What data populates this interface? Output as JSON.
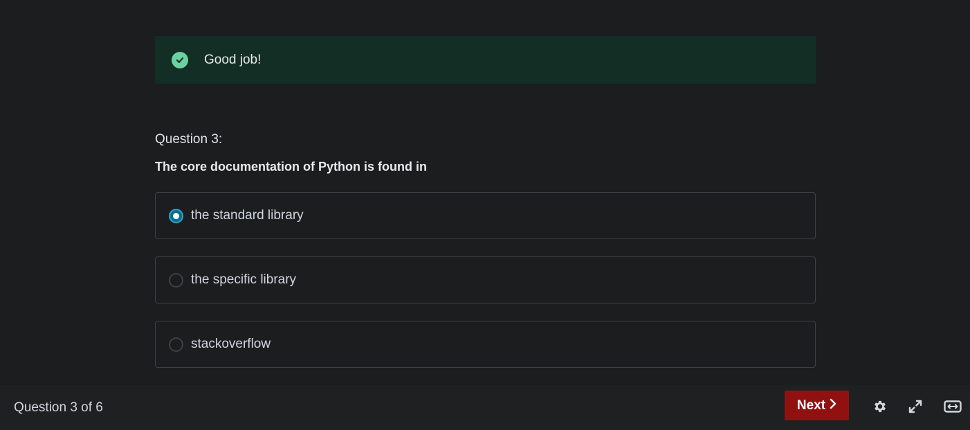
{
  "feedback": {
    "message": "Good job!",
    "icon": "check-circle-icon",
    "color": "#6bd1a0",
    "background": "#132e24"
  },
  "question": {
    "label": "Question 3:",
    "prompt": "The core documentation of Python is found in",
    "answers": [
      {
        "text": "the standard library",
        "selected": true
      },
      {
        "text": "the specific library",
        "selected": false
      },
      {
        "text": "stackoverflow",
        "selected": false
      }
    ]
  },
  "footer": {
    "counter": "Question 3 of 6",
    "next_label": "Next",
    "next_color": "#911111",
    "icons": [
      "settings-gear-icon",
      "fullscreen-expand-icon",
      "expand-width-icon"
    ]
  }
}
